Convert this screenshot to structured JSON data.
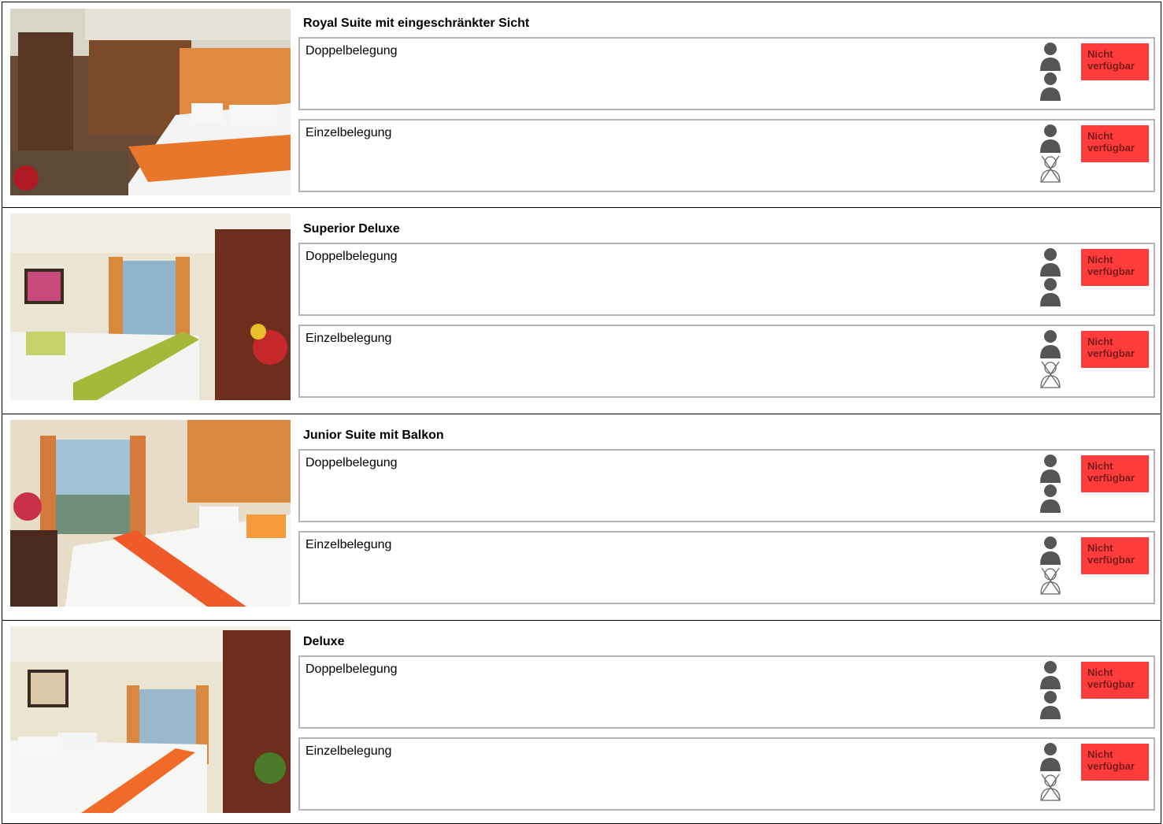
{
  "cabins": [
    {
      "title": "Royal Suite mit eingeschränkter Sicht",
      "photo": "Royal Suite cabin photo",
      "accent": "#e9762a",
      "options": [
        {
          "label": "Doppelbelegung",
          "persons": 2,
          "status": "Nicht verfügbar"
        },
        {
          "label": "Einzelbelegung",
          "persons": 1,
          "status": "Nicht verfügbar"
        }
      ]
    },
    {
      "title": "Superior Deluxe",
      "photo": "Superior Deluxe cabin photo",
      "accent": "#9fb02c",
      "options": [
        {
          "label": "Doppelbelegung",
          "persons": 2,
          "status": "Nicht verfügbar"
        },
        {
          "label": "Einzelbelegung",
          "persons": 1,
          "status": "Nicht verfügbar"
        }
      ]
    },
    {
      "title": "Junior Suite mit Balkon",
      "photo": "Junior Suite cabin photo",
      "accent": "#ee5a2a",
      "options": [
        {
          "label": "Doppelbelegung",
          "persons": 2,
          "status": "Nicht verfügbar"
        },
        {
          "label": "Einzelbelegung",
          "persons": 1,
          "status": "Nicht verfügbar"
        }
      ]
    },
    {
      "title": "Deluxe",
      "photo": "Deluxe cabin photo",
      "accent": "#f06a28",
      "options": [
        {
          "label": "Doppelbelegung",
          "persons": 2,
          "status": "Nicht verfügbar"
        },
        {
          "label": "Einzelbelegung",
          "persons": 1,
          "status": "Nicht verfügbar"
        }
      ]
    }
  ],
  "icons": {
    "person": "person-icon",
    "no_person": "no-person-icon"
  },
  "colors": {
    "unavailable_badge": "#ff3c3c",
    "badge_text": "#7a1a1a",
    "box_border": "#b5b5b5"
  }
}
